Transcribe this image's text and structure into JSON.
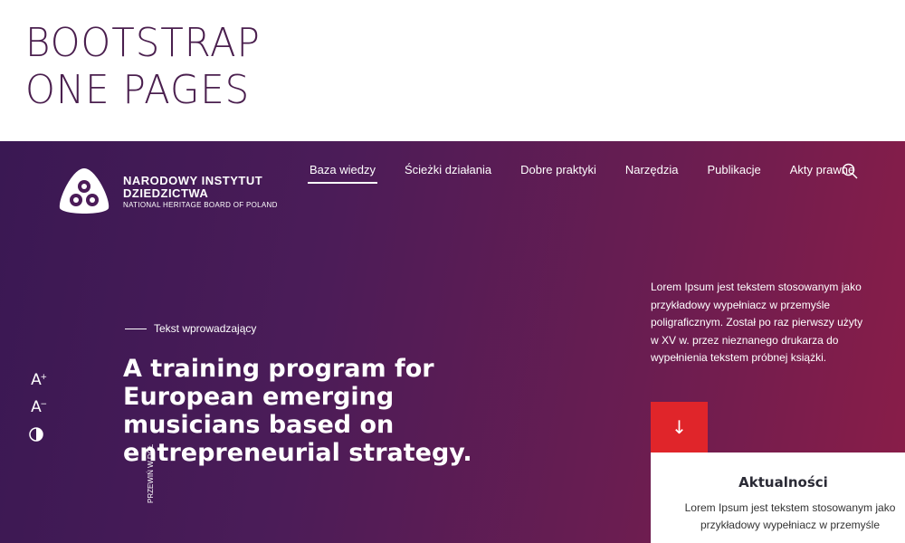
{
  "banner": {
    "line1": "BOOTSTRAP",
    "line2": "ONE PAGES"
  },
  "logo": {
    "name_line1": "NARODOWY INSTYTUT",
    "name_line2": "DZIEDZICTWA",
    "subtitle": "NATIONAL HERITAGE BOARD OF POLAND"
  },
  "nav": {
    "items": [
      {
        "label": "Baza wiedzy",
        "active": true
      },
      {
        "label": "Ścieżki działania"
      },
      {
        "label": "Dobre praktyki"
      },
      {
        "label": "Narzędzia"
      },
      {
        "label": "Publikacje"
      },
      {
        "label": "Akty prawne"
      }
    ]
  },
  "a11y": {
    "increase": "A",
    "decrease": "A"
  },
  "hero": {
    "intro": "Tekst wprowadzający",
    "headline": "A training program for European emerging musicians based on entrepreneurial strategy.",
    "scroll_label": "PRZEWIŃ W DÓŁ",
    "side_text": "Lorem Ipsum jest tekstem stosowanym jako przykładowy wypełniacz w przemyśle poligraficznym. Został po raz pierwszy użyty w XV w. przez nieznanego drukarza do wypełnienia tekstem próbnej książki.",
    "down_arrow": "↓"
  },
  "news": {
    "title": "Aktualności",
    "text": "Lorem Ipsum jest tekstem stosowanym jako przykładowy wypełniacz w przemyśle"
  },
  "colors": {
    "accent_red": "#e0252a",
    "title_purple": "#4a1f4e"
  }
}
